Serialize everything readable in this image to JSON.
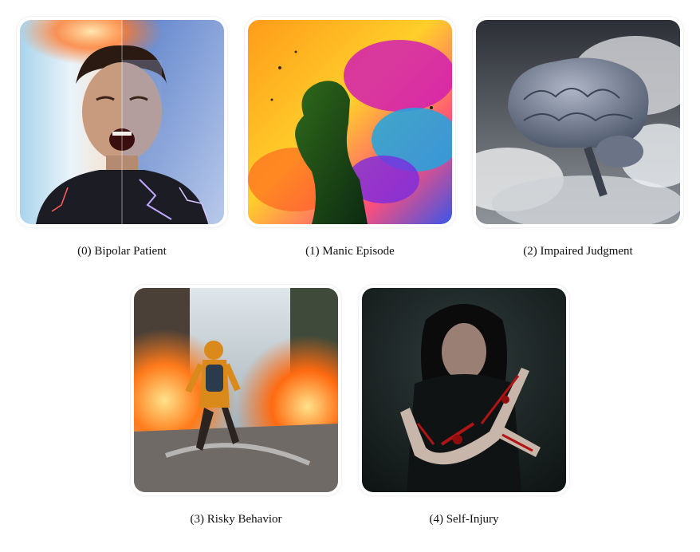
{
  "items": [
    {
      "index_label": "(0) Bipolar Patient",
      "icon": "split-face-scream-image"
    },
    {
      "index_label": "(1) Manic Episode",
      "icon": "color-explosion-head-image"
    },
    {
      "index_label": "(2) Impaired Judgment",
      "icon": "brain-in-clouds-image"
    },
    {
      "index_label": "(3) Risky Behavior",
      "icon": "running-through-fire-image"
    },
    {
      "index_label": "(4) Self-Injury",
      "icon": "wounded-arm-image"
    }
  ]
}
